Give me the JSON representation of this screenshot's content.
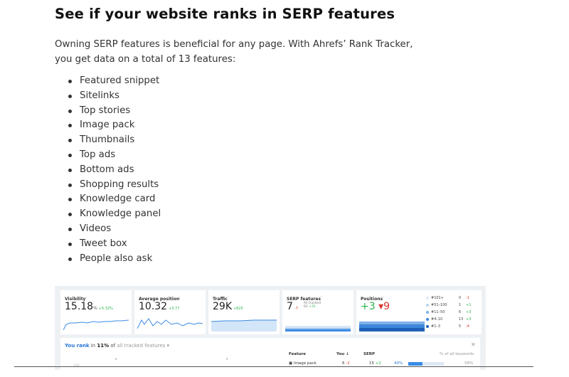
{
  "article": {
    "heading": "See if your website ranks in SERP features",
    "intro": "Owning SERP features is beneficial for any page. With Ahrefs’ Rank Tracker, you get data on a total of 13 features:",
    "features": [
      "Featured snippet",
      "Sitelinks",
      "Top stories",
      "Image pack",
      "Thumbnails",
      "Top ads",
      "Bottom ads",
      "Shopping results",
      "Knowledge card",
      "Knowledge panel",
      "Videos",
      "Tweet box",
      "People also ask"
    ]
  },
  "screenshot": {
    "visibility": {
      "label": "Visibility",
      "value": "15.18",
      "unit": "%",
      "delta": "+5.32%"
    },
    "avg_position": {
      "label": "Average position",
      "value": "10.32",
      "delta": "+3.77"
    },
    "traffic": {
      "label": "Traffic",
      "value": "29K",
      "delta": "+625"
    },
    "serp_features": {
      "label": "SERP features",
      "value": "7",
      "delta": "-7",
      "tracked_label": "All tracked",
      "tracked_value": "62",
      "tracked_delta": "+31"
    },
    "positions": {
      "label": "Positions",
      "up": "+3",
      "down": "9",
      "legend": [
        {
          "range": "#101+",
          "count": "0",
          "change": "-1",
          "color": "#dfe9f5"
        },
        {
          "range": "#51–100",
          "count": "1",
          "change": "+1",
          "color": "#b9d3f0"
        },
        {
          "range": "#11–50",
          "count": "6",
          "change": "+3",
          "color": "#7fb0e8"
        },
        {
          "range": "#4–10",
          "count": "13",
          "change": "+3",
          "color": "#3d87dc"
        },
        {
          "range": "#1–3",
          "count": "5",
          "change": "-4",
          "color": "#1f5fb8"
        }
      ]
    },
    "rank_panel": {
      "prefix": "You rank",
      "in": "in",
      "percent": "11%",
      "of": "of",
      "scope": "all tracked features",
      "columns": {
        "feature": "Feature",
        "you": "You ↓",
        "serp": "SERP",
        "pct": "% of all keywords"
      },
      "row": {
        "feature": "Image pack",
        "you": "6",
        "you_delta": "-2",
        "serp": "15",
        "serp_delta": "+2",
        "pct_text": "40%",
        "pct_value": 40,
        "right_pct": "58%"
      },
      "axis_tick": "100"
    },
    "colors": {
      "accent": "#2a77d8",
      "positive": "#2bb24c",
      "negative": "#d9342b"
    }
  }
}
